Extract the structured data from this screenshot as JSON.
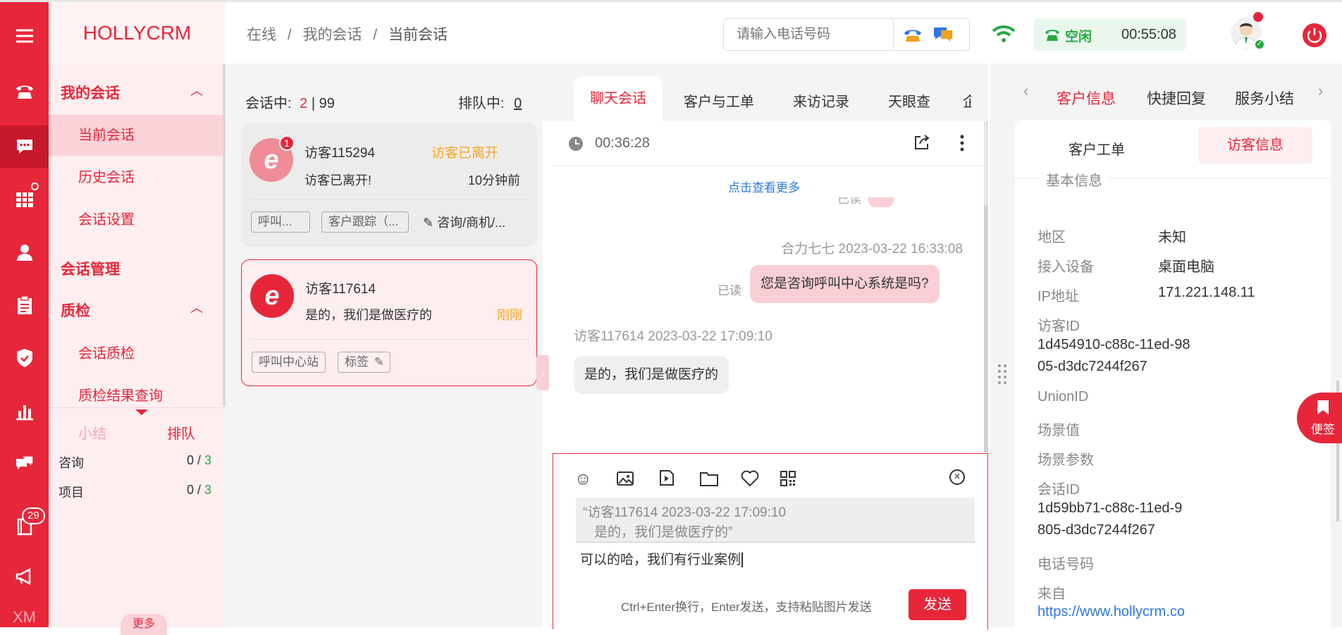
{
  "app": {
    "logo": "HOLLYCRM"
  },
  "rail": {
    "queue_badge": "29",
    "bottom_label": "XM"
  },
  "nav": {
    "group_my_sessions": "我的会话",
    "item_current": "当前会话",
    "item_history": "历史会话",
    "item_settings": "会话设置",
    "group_manage": "会话管理",
    "group_qc": "质检",
    "item_qc": "会话质检",
    "item_qc_result": "质检结果查询",
    "tab_summary": "小结",
    "tab_queue": "排队",
    "stats": [
      {
        "label": "咨询",
        "done": "0",
        "total": "3"
      },
      {
        "label": "项目",
        "done": "0",
        "total": "3"
      }
    ],
    "more": "更多"
  },
  "breadcrumb": {
    "a": "在线",
    "b": "我的会话",
    "c": "当前会话",
    "sep": "/"
  },
  "header": {
    "phone_placeholder": "请输入电话号码",
    "status_label": "空闲",
    "timer": "00:55:08"
  },
  "sessions": {
    "active_label": "会话中:",
    "active_count": "2",
    "sep": "|",
    "active_max": "99",
    "queue_label": "排队中:",
    "queue_count": "0",
    "cards": [
      {
        "name": "访客115294",
        "status": "访客已离开",
        "msg": "访客已离开!",
        "time": "10分钟前",
        "unread": "1",
        "tags": [
          "呼叫...",
          "客户跟踪（...",
          "咨询/商机/..."
        ]
      },
      {
        "name": "访客117614",
        "msg": "是的，我们是做医疗的",
        "time": "刚刚",
        "tags": [
          "呼叫中心站",
          "标签"
        ]
      }
    ]
  },
  "chat_tabs": [
    "聊天会话",
    "客户与工单",
    "来访记录",
    "天眼查"
  ],
  "chat": {
    "duration": "00:36:28",
    "load_more": "点击查看更多",
    "read_partial": "已读",
    "msg1_meta": "合力七七 2023-03-22 16:33:08",
    "msg1_text": "您是咨询呼叫中心系统是吗?",
    "msg1_read": "已读",
    "msg2_meta": "访客117614 2023-03-22 17:09:10",
    "msg2_text": "是的，我们是做医疗的",
    "quote_line1": "“访客117614 2023-03-22 17:09:10",
    "quote_line2": "是的，我们是做医疗的”",
    "input_text": "可以的哈，我们有行业案例",
    "hint": "Ctrl+Enter换行，Enter发送，支持粘贴图片发送",
    "send": "发送"
  },
  "right_tabs": [
    "客户信息",
    "快捷回复",
    "服务小结"
  ],
  "info": {
    "sub_tab_a": "客户工单",
    "sub_tab_b": "访客信息",
    "section": "基本信息",
    "region_k": "地区",
    "region_v": "未知",
    "device_k": "接入设备",
    "device_v": "桌面电脑",
    "ip_k": "IP地址",
    "ip_v": "171.221.148.11",
    "vid_k": "访客ID",
    "vid_v1": "1d454910-c88c-11ed-98",
    "vid_v2": "05-d3dc7244f267",
    "union_k": "UnionID",
    "scene_k": "场景值",
    "param_k": "场景参数",
    "sid_k": "会话ID",
    "sid_v1": "1d59bb71-c88c-11ed-9",
    "sid_v2": "805-d3dc7244f267",
    "phone_k": "电话号码",
    "from_k": "来自",
    "from_v": "https://www.hollycrm.co"
  },
  "float": {
    "note": "便签"
  },
  "colors": {
    "brand": "#e8263a",
    "nav_bg": "#fdeef0",
    "bubble_me": "#f9cfd5",
    "status_green": "#27a844"
  }
}
